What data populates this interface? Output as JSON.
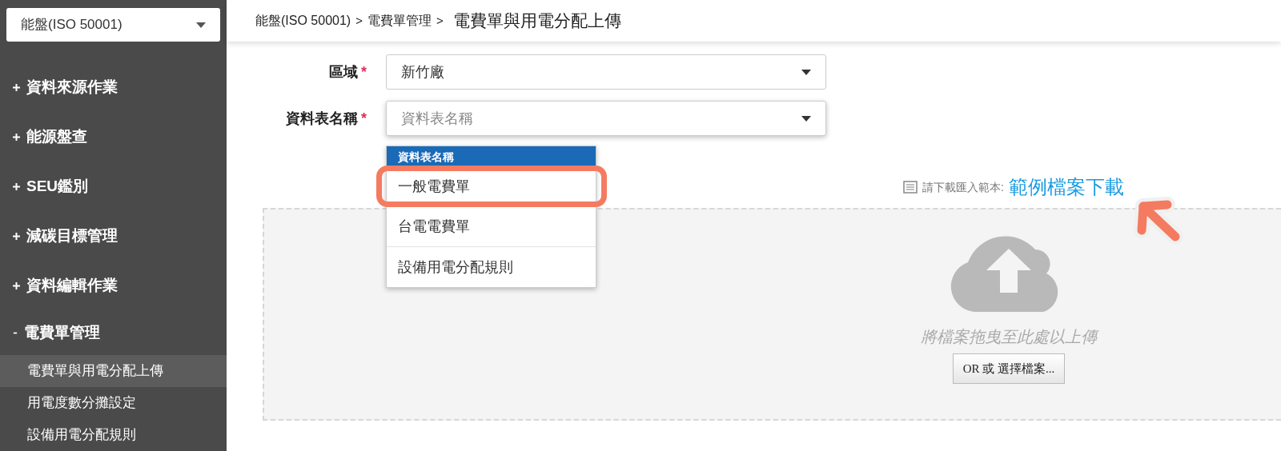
{
  "module_select": {
    "value": "能盤(ISO 50001)"
  },
  "sidebar": {
    "items": [
      {
        "label": "資料來源作業",
        "expanded": false
      },
      {
        "label": "能源盤查",
        "expanded": false
      },
      {
        "label": "SEU鑑別",
        "expanded": false
      },
      {
        "label": "減碳目標管理",
        "expanded": false
      },
      {
        "label": "資料編輯作業",
        "expanded": false
      },
      {
        "label": "電費單管理",
        "expanded": true,
        "children": [
          {
            "label": "電費單與用電分配上傳",
            "selected": true
          },
          {
            "label": "用電度數分攤設定",
            "selected": false
          },
          {
            "label": "設備用電分配規則",
            "selected": false
          }
        ]
      }
    ]
  },
  "breadcrumb": [
    {
      "label": "能盤(ISO 50001)",
      "separator": ">"
    },
    {
      "label": "電費單管理",
      "separator": ">"
    }
  ],
  "page_title": "電費單與用電分配上傳",
  "form": {
    "fields": [
      {
        "label": "區域",
        "required_mark": "*",
        "value": "新竹廠",
        "open": false
      },
      {
        "label": "資料表名稱",
        "required_mark": "*",
        "placeholder": "資料表名稱",
        "open": true,
        "dropdown": {
          "header": "資料表名稱",
          "options": [
            {
              "label": "一般電費單",
              "annotated": true
            },
            {
              "label": "台電電費單",
              "annotated": false
            },
            {
              "label": "設備用電分配規則",
              "annotated": false
            }
          ]
        }
      }
    ]
  },
  "template": {
    "label": "請下載匯入範本:",
    "link": "範例檔案下載"
  },
  "upload": {
    "hint": "將檔案拖曳至此處以上傳",
    "button": "OR 或 選擇檔案..."
  }
}
